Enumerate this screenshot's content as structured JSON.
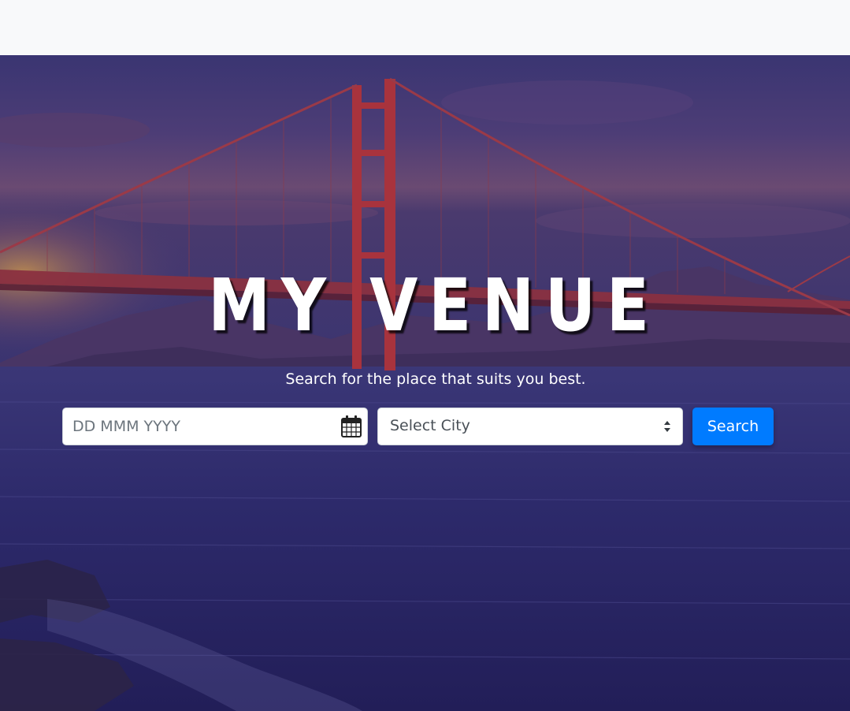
{
  "hero": {
    "title": "MY VENUE",
    "subtitle": "Search for the place that suits you best."
  },
  "search": {
    "date_placeholder": "DD MMM YYYY",
    "date_icon": "calendar-icon",
    "city_select_value": "Select City",
    "city_select_icon": "sort-caret-icon",
    "button_label": "Search"
  },
  "colors": {
    "navbar_bg": "#f8f9fa",
    "hero_overlay": "#2a2864",
    "primary_button": "#007bff",
    "title_text": "#ffffff"
  }
}
